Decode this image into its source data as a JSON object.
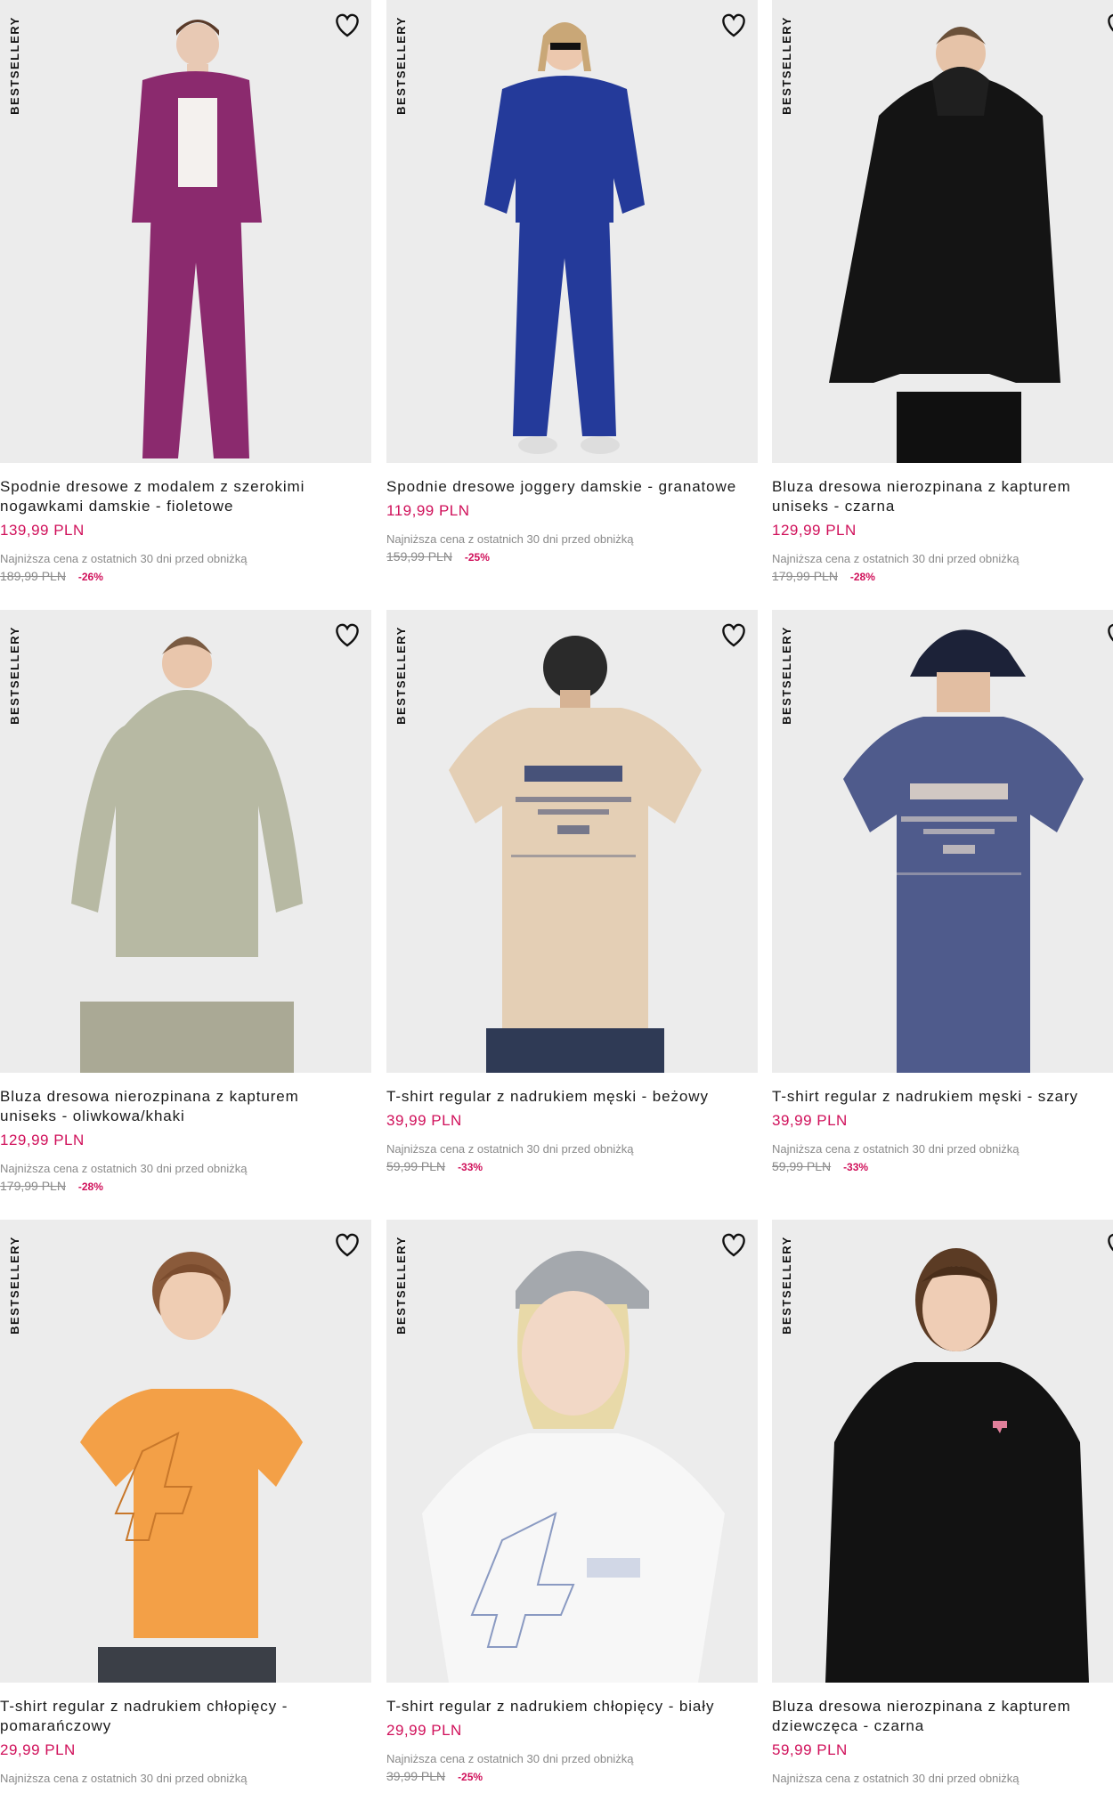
{
  "badge_label": "BESTSELLERY",
  "lowest_label": "Najniższa cena z ostatnich 30 dni przed obniżką",
  "products": [
    {
      "name": "Spodnie dresowe z modalem z szerokimi nogawkami damskie - fioletowe",
      "price": "139,99 PLN",
      "old_price": "189,99 PLN",
      "discount": "-26%",
      "color": "#8b2a6e",
      "icon": "heart-outline"
    },
    {
      "name": "Spodnie dresowe joggery damskie - granatowe",
      "price": "119,99 PLN",
      "old_price": "159,99 PLN",
      "discount": "-25%",
      "color": "#243a9a",
      "icon": "heart-outline"
    },
    {
      "name": "Bluza dresowa nierozpinana z kapturem uniseks - czarna",
      "price": "129,99 PLN",
      "old_price": "179,99 PLN",
      "discount": "-28%",
      "color": "#141414",
      "icon": "heart-outline"
    },
    {
      "name": "Bluza dresowa nierozpinana z kapturem uniseks - oliwkowa/khaki",
      "price": "129,99 PLN",
      "old_price": "179,99 PLN",
      "discount": "-28%",
      "color": "#b7b9a3",
      "icon": "heart-outline"
    },
    {
      "name": "T-shirt regular z nadrukiem męski - beżowy",
      "price": "39,99 PLN",
      "old_price": "59,99 PLN",
      "discount": "-33%",
      "color": "#e4cfb5",
      "icon": "heart-outline"
    },
    {
      "name": "T-shirt regular z nadrukiem męski - szary",
      "price": "39,99 PLN",
      "old_price": "59,99 PLN",
      "discount": "-33%",
      "color": "#4f5b8c",
      "icon": "heart-outline"
    },
    {
      "name": "T-shirt regular z nadrukiem chłopięcy - pomarańczowy",
      "price": "29,99 PLN",
      "old_price": "",
      "discount": "",
      "color": "#f3a047",
      "icon": "heart-outline"
    },
    {
      "name": "T-shirt regular z nadrukiem chłopięcy - biały",
      "price": "29,99 PLN",
      "old_price": "39,99 PLN",
      "discount": "-25%",
      "color": "#f7f7f7",
      "icon": "heart-outline"
    },
    {
      "name": "Bluza dresowa nierozpinana z kapturem dziewczęca - czarna",
      "price": "59,99 PLN",
      "old_price": "",
      "discount": "",
      "color": "#121212",
      "icon": "heart-outline"
    }
  ]
}
